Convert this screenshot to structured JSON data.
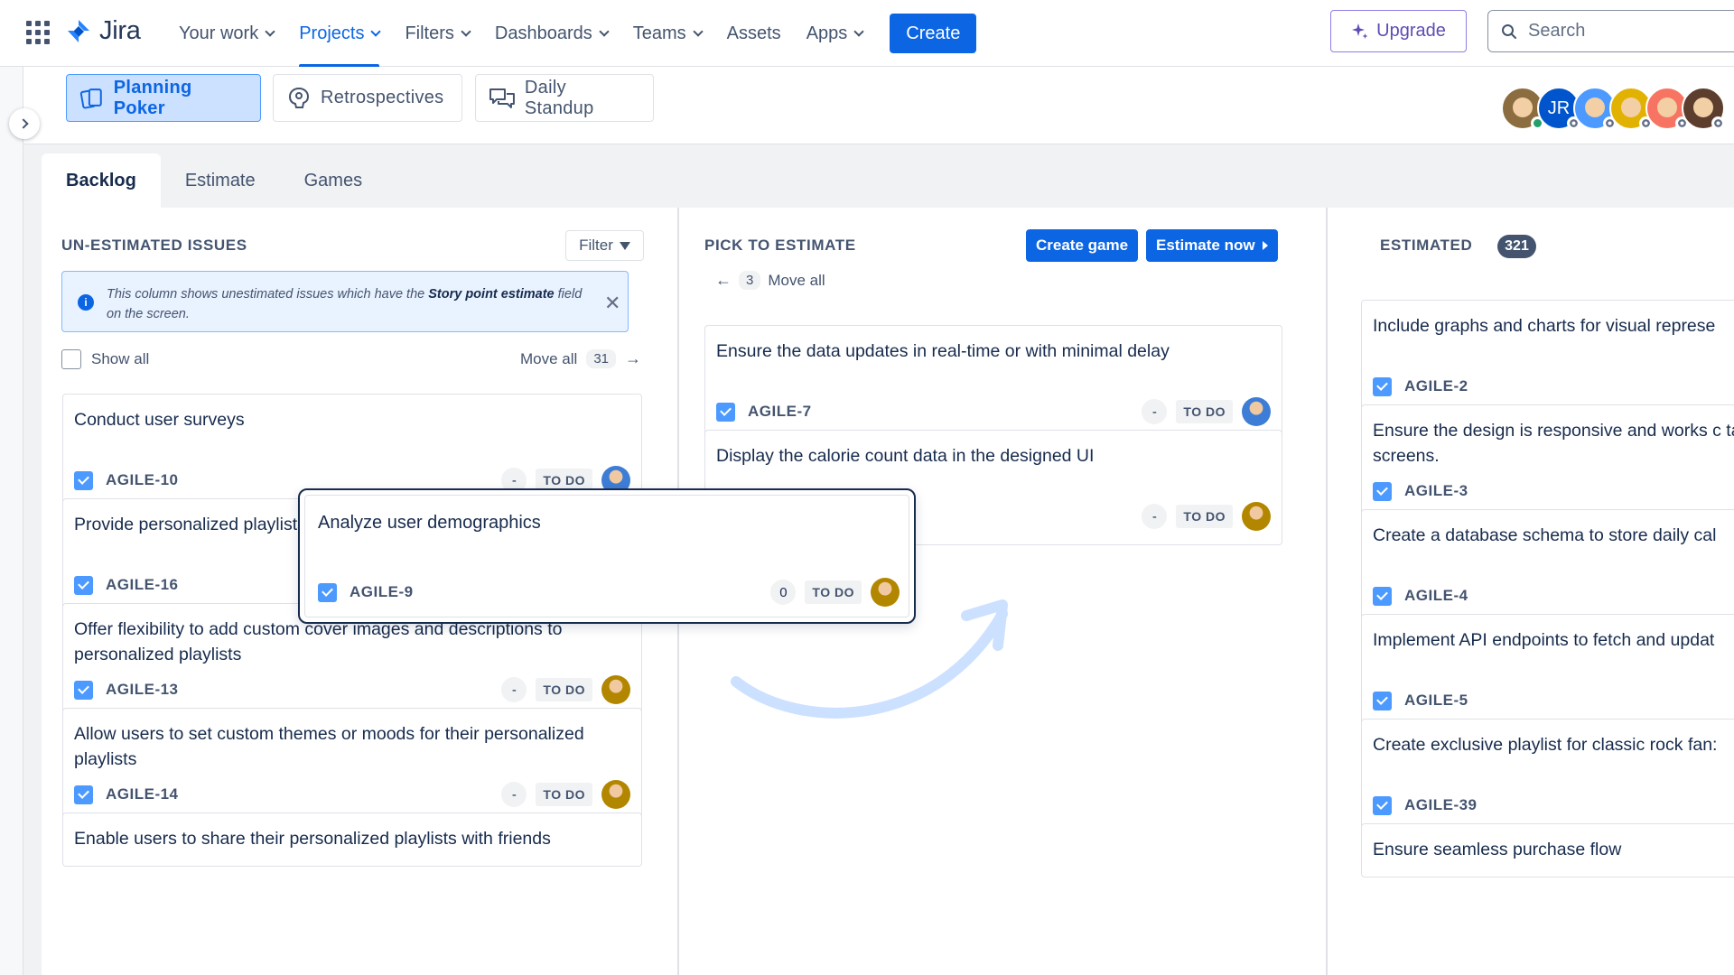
{
  "nav": {
    "logo_text": "Jira",
    "items": [
      {
        "label": "Your work",
        "dropdown": true
      },
      {
        "label": "Projects",
        "dropdown": true,
        "active": true
      },
      {
        "label": "Filters",
        "dropdown": true
      },
      {
        "label": "Dashboards",
        "dropdown": true
      },
      {
        "label": "Teams",
        "dropdown": true
      },
      {
        "label": "Assets",
        "dropdown": false
      },
      {
        "label": "Apps",
        "dropdown": true
      }
    ],
    "create_label": "Create",
    "upgrade_label": "Upgrade",
    "search_placeholder": "Search"
  },
  "app_toolbar": {
    "planning_poker": "Planning Poker",
    "retrospectives": "Retrospectives",
    "daily_standup": "Daily Standup",
    "avatars": [
      {
        "initials": "",
        "color": "#8B6D3F",
        "status": "online"
      },
      {
        "initials": "JR",
        "color": "#0055CC",
        "status": "offline"
      },
      {
        "initials": "",
        "color": "#4C9AFF",
        "status": "offline"
      },
      {
        "initials": "",
        "color": "#E2B203",
        "status": "offline"
      },
      {
        "initials": "",
        "color": "#F87462",
        "status": "offline"
      },
      {
        "initials": "",
        "color": "#5C3D2E",
        "status": "offline"
      }
    ]
  },
  "tabs": [
    "Backlog",
    "Estimate",
    "Games"
  ],
  "columns": {
    "unestimated": {
      "title": "UN-ESTIMATED ISSUES",
      "filter_label": "Filter",
      "info_prefix": "This column shows unestimated issues which have the ",
      "info_bold": "Story point estimate",
      "info_suffix": " field on the screen.",
      "show_all_label": "Show all",
      "move_all_label": "Move all",
      "move_all_count": "31",
      "cards": [
        {
          "title": "Conduct user surveys",
          "key": "AGILE-10",
          "estimate": "-",
          "status": "TO DO",
          "avatar": "#3E7DD6"
        },
        {
          "title": "Provide personalized playlists based on listening history",
          "key": "AGILE-16",
          "estimate": "-",
          "status": "TO DO",
          "avatar": "#B38600"
        },
        {
          "title": "Offer flexibility to add custom cover images and descriptions to personalized playlists",
          "key": "AGILE-13",
          "estimate": "-",
          "status": "TO DO",
          "avatar": "#B38600"
        },
        {
          "title": "Allow users to set custom themes or moods for their personalized playlists",
          "key": "AGILE-14",
          "estimate": "-",
          "status": "TO DO",
          "avatar": "#B38600"
        },
        {
          "title": "Enable users to share their personalized playlists with friends",
          "key": "",
          "estimate": "",
          "status": "",
          "avatar": ""
        }
      ]
    },
    "pick": {
      "title": "PICK TO ESTIMATE",
      "create_game_label": "Create game",
      "estimate_now_label": "Estimate now",
      "move_all_count": "3",
      "move_all_label": "Move all",
      "cards": [
        {
          "title": "Ensure the data updates in real-time or with minimal delay",
          "key": "AGILE-7",
          "estimate": "-",
          "status": "TO DO",
          "avatar": "#3E7DD6"
        },
        {
          "title": "Display the calorie count data in the designed UI",
          "key": "",
          "estimate": "-",
          "status": "TO DO",
          "avatar": "#B38600"
        }
      ]
    },
    "estimated": {
      "title": "ESTIMATED",
      "count": "321",
      "cards": [
        {
          "title": "Include graphs and charts for visual represe",
          "key": "AGILE-2"
        },
        {
          "title": "Ensure the design is responsive and works c tablet screens.",
          "key": "AGILE-3"
        },
        {
          "title": "Create a database schema to store daily cal",
          "key": "AGILE-4"
        },
        {
          "title": "Implement API endpoints to fetch and updat",
          "key": "AGILE-5"
        },
        {
          "title": "Create exclusive playlist for classic rock fan:",
          "key": "AGILE-39"
        },
        {
          "title": "Ensure seamless purchase flow",
          "key": ""
        }
      ]
    }
  },
  "dragging_card": {
    "title": "Analyze user demographics",
    "key": "AGILE-9",
    "estimate": "0",
    "status": "TO DO",
    "avatar": "#B38600"
  },
  "colors": {
    "accent": "#0C66E4",
    "upgrade": "#5E4DB2",
    "checkbox": "#4C9AFF",
    "swoosh": "#CCE0FF"
  }
}
